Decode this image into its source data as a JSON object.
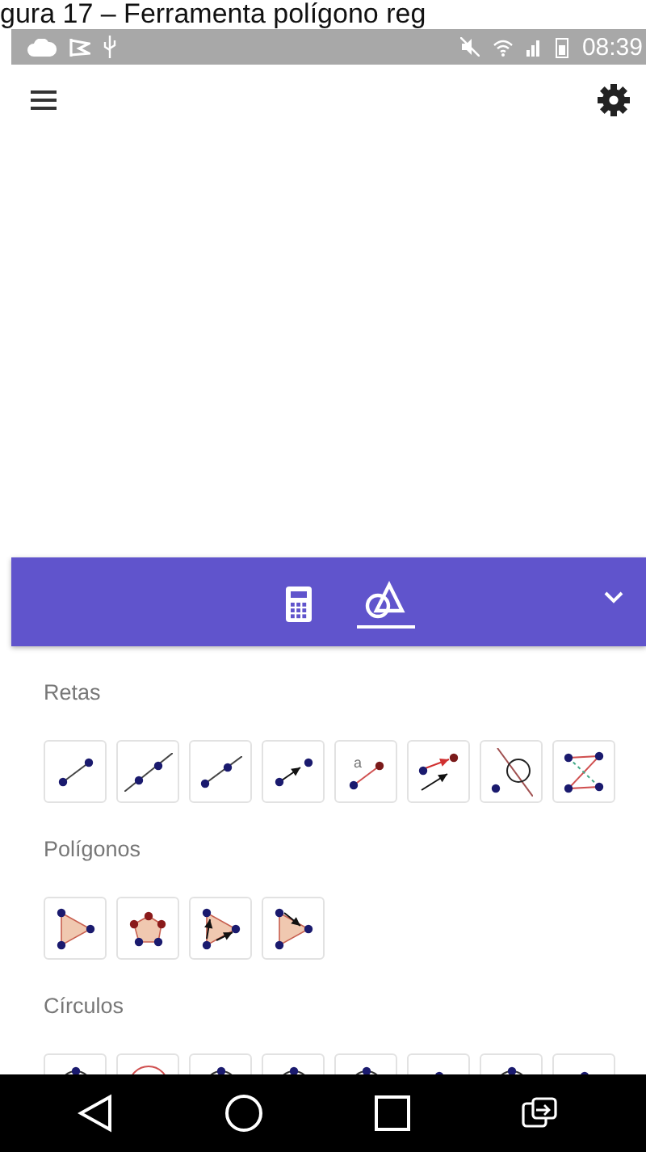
{
  "caption": "gura 17 – Ferramenta polígono reg",
  "status_bar": {
    "time": "08:39"
  },
  "panel_tabs": [
    {
      "kind": "calculator",
      "selected": false
    },
    {
      "kind": "tools",
      "selected": true
    }
  ],
  "sections": [
    {
      "title": "Retas",
      "tools": [
        {
          "kind": "segment"
        },
        {
          "kind": "line"
        },
        {
          "kind": "ray"
        },
        {
          "kind": "vector"
        },
        {
          "kind": "segment-length",
          "label": "a"
        },
        {
          "kind": "vector-from-point"
        },
        {
          "kind": "circle-line"
        },
        {
          "kind": "polyline"
        }
      ]
    },
    {
      "title": "Polígonos",
      "tools": [
        {
          "kind": "polygon"
        },
        {
          "kind": "regular-polygon"
        },
        {
          "kind": "rigid-polygon"
        },
        {
          "kind": "vector-polygon"
        }
      ]
    },
    {
      "title": "Círculos",
      "tools": [
        {
          "kind": "circle"
        },
        {
          "kind": "circle-red"
        },
        {
          "kind": "circle"
        },
        {
          "kind": "circle"
        },
        {
          "kind": "circle"
        },
        {
          "kind": "arc"
        },
        {
          "kind": "circle"
        },
        {
          "kind": "arc"
        }
      ]
    }
  ]
}
